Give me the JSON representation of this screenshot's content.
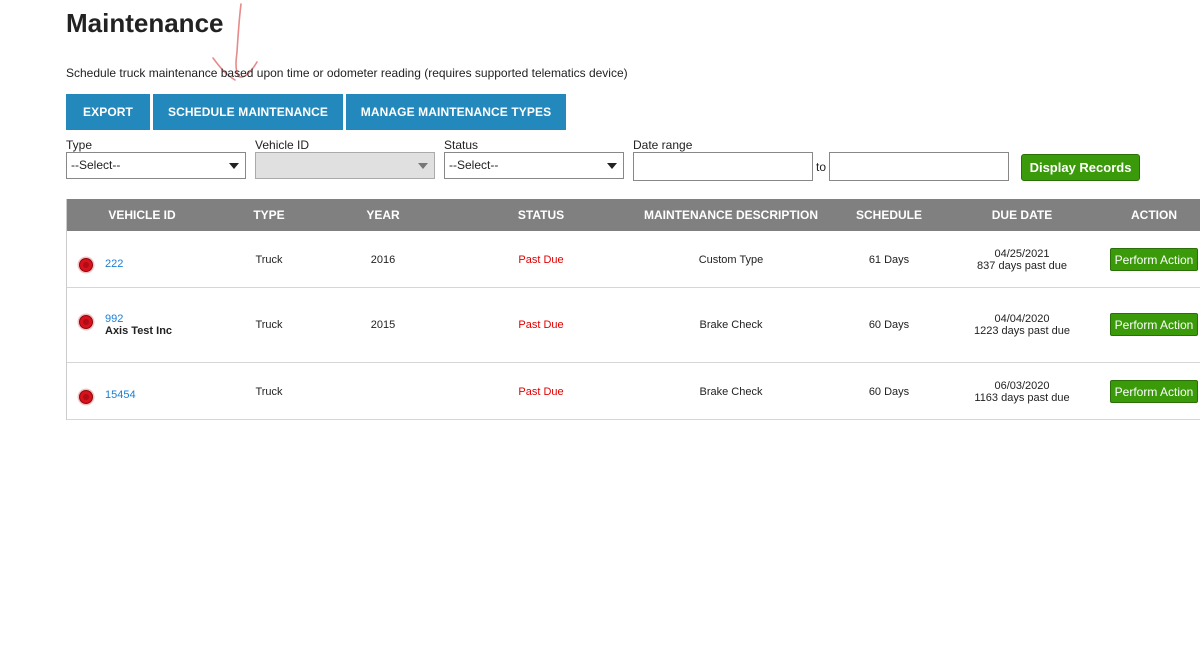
{
  "page": {
    "title": "Maintenance",
    "subtitle": "Schedule truck maintenance based upon time or odometer reading (requires supported telematics device)"
  },
  "toolbar": {
    "export_label": "EXPORT",
    "schedule_label": "SCHEDULE MAINTENANCE",
    "manage_types_label": "MANAGE MAINTENANCE TYPES",
    "color": "#2389bd"
  },
  "filters": {
    "type_label": "Type",
    "type_value": "--Select--",
    "vehicle_label": "Vehicle ID",
    "vehicle_value": "",
    "status_label": "Status",
    "status_value": "--Select--",
    "date_label": "Date range",
    "date_from": "",
    "date_to": "",
    "to_label": "to",
    "display_label": "Display Records"
  },
  "table": {
    "headers": {
      "vehicle_id": "VEHICLE ID",
      "type": "TYPE",
      "year": "YEAR",
      "status": "STATUS",
      "description": "MAINTENANCE DESCRIPTION",
      "schedule": "SCHEDULE",
      "due_date": "DUE DATE",
      "action": "ACTION"
    },
    "rows": [
      {
        "vehicle_id": "222",
        "vehicle_sub": "",
        "type": "Truck",
        "year": "2016",
        "status": "Past Due",
        "description": "Custom Type",
        "schedule": "61 Days",
        "due_date": "04/25/2021",
        "due_note": "837 days past due",
        "action": "Perform Action"
      },
      {
        "vehicle_id": "992",
        "vehicle_sub": "Axis Test Inc",
        "type": "Truck",
        "year": "2015",
        "status": "Past Due",
        "description": "Brake Check",
        "schedule": "60 Days",
        "due_date": "04/04/2020",
        "due_note": "1223 days past due",
        "action": "Perform Action"
      },
      {
        "vehicle_id": "15454",
        "vehicle_sub": "",
        "type": "Truck",
        "year": "",
        "status": "Past Due",
        "description": "Brake Check",
        "schedule": "60 Days",
        "due_date": "06/03/2020",
        "due_note": "1163 days past due",
        "action": "Perform Action"
      }
    ]
  },
  "colors": {
    "header_bg": "#808080",
    "action_green": "#3a9a0a",
    "past_due_red": "#e00000",
    "link_blue": "#1a7fd4",
    "status_dot": "#d8111c"
  }
}
